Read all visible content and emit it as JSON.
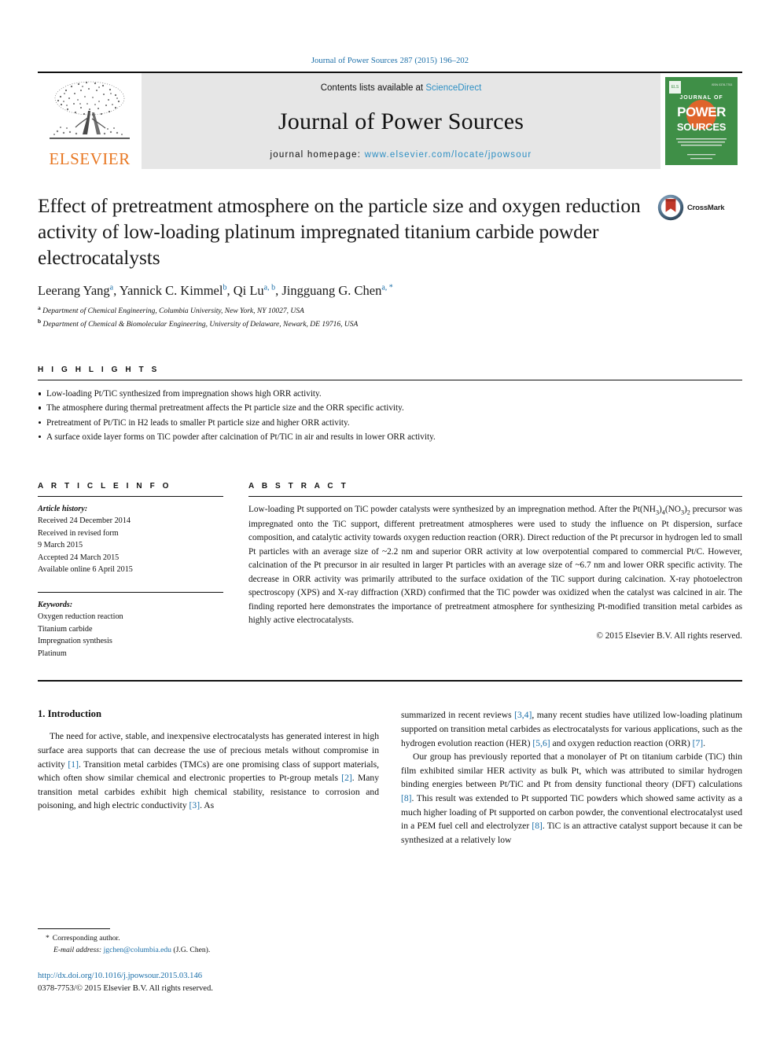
{
  "running_head": "Journal of Power Sources 287 (2015) 196–202",
  "masthead": {
    "publisher_name": "ELSEVIER",
    "contents_prefix": "Contents lists available at ",
    "contents_link": "ScienceDirect",
    "journal_name": "Journal of Power Sources",
    "homepage_prefix": "journal homepage: ",
    "homepage_url": "www.elsevier.com/locate/jpowsour",
    "cover": {
      "line1": "JOURNAL OF",
      "line2": "POWER",
      "line3": "SOURCES",
      "caption": "An international journal on the Science and Technology of electrochemical energy conversion and storage, including fuel cells, batteries and supercapacitors",
      "footer": "Available online at ScienceDirect"
    }
  },
  "article": {
    "title": "Effect of pretreatment atmosphere on the particle size and oxygen reduction activity of low-loading platinum impregnated titanium carbide powder electrocatalysts",
    "crossmark_label": "CrossMark",
    "authors": [
      {
        "name": "Leerang Yang",
        "marks": "a",
        "sep": ", "
      },
      {
        "name": "Yannick C. Kimmel",
        "marks": "b",
        "sep": ", "
      },
      {
        "name": "Qi Lu",
        "marks": "a, b",
        "sep": ", "
      },
      {
        "name": "Jingguang G. Chen",
        "marks": "a, *",
        "sep": ""
      }
    ],
    "affiliations": [
      {
        "mark": "a",
        "text": "Department of Chemical Engineering, Columbia University, New York, NY 10027, USA"
      },
      {
        "mark": "b",
        "text": "Department of Chemical & Biomolecular Engineering, University of Delaware, Newark, DE 19716, USA"
      }
    ]
  },
  "highlights": {
    "label": "H I G H L I G H T S",
    "items": [
      "Low-loading Pt/TiC synthesized from impregnation shows high ORR activity.",
      "The atmosphere during thermal pretreatment affects the Pt particle size and the ORR specific activity.",
      "Pretreatment of Pt/TiC in H2 leads to smaller Pt particle size and higher ORR activity.",
      "A surface oxide layer forms on TiC powder after calcination of Pt/TiC in air and results in lower ORR activity."
    ]
  },
  "article_info": {
    "label": "A R T I C L E  I N F O",
    "history_head": "Article history:",
    "history_lines": [
      "Received 24 December 2014",
      "Received in revised form",
      "9 March 2015",
      "Accepted 24 March 2015",
      "Available online 6 April 2015"
    ],
    "keywords_head": "Keywords:",
    "keywords": [
      "Oxygen reduction reaction",
      "Titanium carbide",
      "Impregnation synthesis",
      "Platinum"
    ]
  },
  "abstract": {
    "label": "A B S T R A C T",
    "part1": "Low-loading Pt supported on TiC powder catalysts were synthesized by an impregnation method. After the Pt(NH",
    "sub1": "3",
    "part2": ")",
    "sub2": "4",
    "part3": "(NO",
    "sub3": "3",
    "part4": ")",
    "sub4": "2",
    "part5": " precursor was impregnated onto the TiC support, different pretreatment atmospheres were used to study the influence on Pt dispersion, surface composition, and catalytic activity towards oxygen reduction reaction (ORR). Direct reduction of the Pt precursor in hydrogen led to small Pt particles with an average size of ~2.2 nm and superior ORR activity at low overpotential compared to commercial Pt/C. However, calcination of the Pt precursor in air resulted in larger Pt particles with an average size of ~6.7 nm and lower ORR specific activity. The decrease in ORR activity was primarily attributed to the surface oxidation of the TiC support during calcination. X-ray photoelectron spectroscopy (XPS) and X-ray diffraction (XRD) confirmed that the TiC powder was oxidized when the catalyst was calcined in air. The finding reported here demonstrates the importance of pretreatment atmosphere for synthesizing Pt-modified transition metal carbides as highly active electrocatalysts.",
    "copyright": "© 2015 Elsevier B.V. All rights reserved."
  },
  "body": {
    "section_heading": "1. Introduction",
    "left_p1_a": "The need for active, stable, and inexpensive electrocatalysts has generated interest in high surface area supports that can decrease the use of precious metals without compromise in activity ",
    "left_ref1": "[1]",
    "left_p1_b": ". Transition metal carbides (TMCs) are one promising class of support materials, which often show similar chemical and electronic properties to Pt-group metals ",
    "left_ref2": "[2]",
    "left_p1_c": ". Many transition metal carbides exhibit high chemical stability, resistance to corrosion and poisoning, and high electric conductivity ",
    "left_ref3": "[3]",
    "left_p1_d": ". As",
    "right_p1_a": "summarized in recent reviews ",
    "right_ref1": "[3,4]",
    "right_p1_b": ", many recent studies have utilized low-loading platinum supported on transition metal carbides as electrocatalysts for various applications, such as the hydrogen evolution reaction (HER) ",
    "right_ref2": "[5,6]",
    "right_p1_c": " and oxygen reduction reaction (ORR) ",
    "right_ref3": "[7]",
    "right_p1_d": ".",
    "right_p2_a": "Our group has previously reported that a monolayer of Pt on titanium carbide (TiC) thin film exhibited similar HER activity as bulk Pt, which was attributed to similar hydrogen binding energies between Pt/TiC and Pt from density functional theory (DFT) calculations ",
    "right_ref4": "[8]",
    "right_p2_b": ". This result was extended to Pt supported TiC powders which showed same activity as a much higher loading of Pt supported on carbon powder, the conventional electrocatalyst used in a PEM fuel cell and electrolyzer ",
    "right_ref5": "[8]",
    "right_p2_c": ". TiC is an attractive catalyst support because it can be synthesized at a relatively low"
  },
  "footer": {
    "corresponding_star": "*",
    "corresponding_label": "Corresponding author.",
    "email_label": "E-mail address:",
    "email": "jgchen@columbia.edu",
    "email_suffix": "(J.G. Chen).",
    "doi": "http://dx.doi.org/10.1016/j.jpowsour.2015.03.146",
    "issn": "0378-7753/© 2015 Elsevier B.V. All rights reserved."
  },
  "colors": {
    "link": "#1a6ea8",
    "sciencedirect": "#2d8fc4",
    "elsevier_orange": "#E87722",
    "cover_green": "#3f8f47",
    "masthead_gray": "#e6e6e6"
  }
}
